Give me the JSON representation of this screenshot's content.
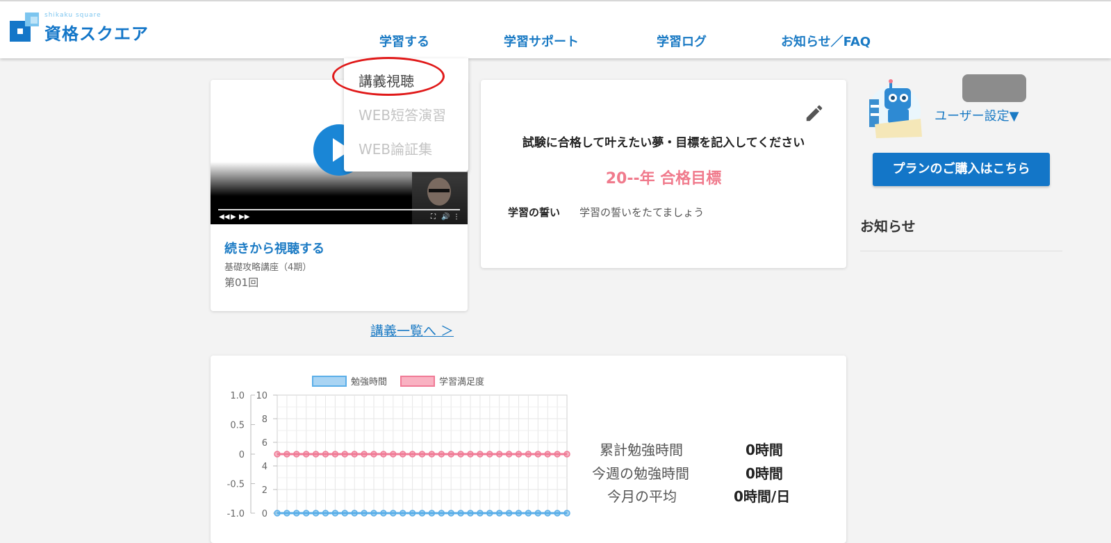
{
  "header": {
    "logo_sub": "shikaku square",
    "logo_name": "資格スクエア",
    "nav": [
      {
        "label": "学習する"
      },
      {
        "label": "学習サポート"
      },
      {
        "label": "学習ログ"
      },
      {
        "label": "お知らせ／FAQ"
      }
    ]
  },
  "dropdown": {
    "items": [
      {
        "label": "講義視聴",
        "enabled": true
      },
      {
        "label": "WEB短答演習",
        "enabled": false
      },
      {
        "label": "WEB論証集",
        "enabled": false
      }
    ],
    "highlighted_item": "講義視聴"
  },
  "video_card": {
    "title": "続きから視聴する",
    "course": "基礎攻略講座（4期）",
    "episode": "第01回"
  },
  "lecture_link": "講義一覧へ ＞",
  "goal_card": {
    "prompt": "試験に合格して叶えたい夢・目標を記入してください",
    "year_goal": "20--年 合格目標",
    "vow_label": "学習の誓い",
    "vow_placeholder": "学習の誓いをたてましょう"
  },
  "user": {
    "settings_label": "ユーザー設定▼"
  },
  "plan_button": "プランのご購入はこちら",
  "news": {
    "heading": "お知らせ"
  },
  "stats": {
    "total_label": "累計勉強時間",
    "total_value": "0時間",
    "week_label": "今週の勉強時間",
    "week_value": "0時間",
    "month_label": "今月の平均",
    "month_value": "0時間/日"
  },
  "colors": {
    "brand_blue": "#1376c8",
    "link_blue": "#1a7ac4",
    "goal_pink": "#f07a8c",
    "series_study": "#5aaee8",
    "series_satisfaction": "#f07a96",
    "annotation_red": "#e01919"
  },
  "chart_data": {
    "type": "line",
    "legend_placement": "top",
    "grid": true,
    "series": [
      {
        "name": "勉強時間",
        "axis": "right",
        "values": [
          0,
          0,
          0,
          0,
          0,
          0,
          0,
          0,
          0,
          0,
          0,
          0,
          0,
          0,
          0,
          0,
          0,
          0,
          0,
          0,
          0,
          0,
          0,
          0,
          0,
          0,
          0,
          0,
          0,
          0,
          0
        ]
      },
      {
        "name": "学習満足度",
        "axis": "left",
        "values": [
          0,
          0,
          0,
          0,
          0,
          0,
          0,
          0,
          0,
          0,
          0,
          0,
          0,
          0,
          0,
          0,
          0,
          0,
          0,
          0,
          0,
          0,
          0,
          0,
          0,
          0,
          0,
          0,
          0,
          0,
          0
        ]
      }
    ],
    "left_axis": {
      "ticks": [
        "1.0",
        "0.5",
        "0",
        "-0.5",
        "-1.0"
      ],
      "range": [
        -1,
        1
      ]
    },
    "right_axis": {
      "ticks": [
        "10",
        "8",
        "6",
        "4",
        "2",
        "0"
      ],
      "range": [
        0,
        10
      ]
    }
  }
}
